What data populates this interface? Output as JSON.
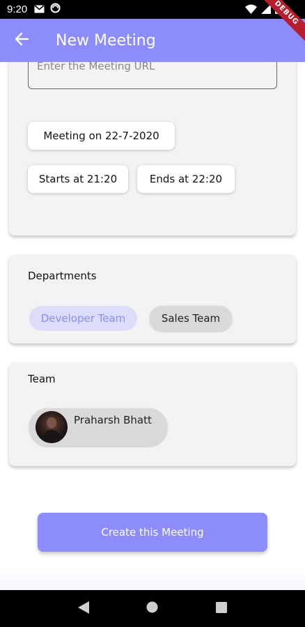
{
  "status_bar": {
    "time": "9:20",
    "icons": [
      "gmail-icon",
      "sync-icon",
      "wifi-icon",
      "signal-icon",
      "battery-icon"
    ]
  },
  "debug_banner": "DEBUG",
  "app_bar": {
    "title": "New Meeting",
    "back_icon": "arrow-back-icon",
    "background": "#8c8cfb"
  },
  "meeting_details": {
    "url_placeholder": "Enter the Meeting URL",
    "date_label": "Meeting on 22-7-2020",
    "start_label": "Starts at 21:20",
    "end_label": "Ends at 22:20"
  },
  "departments": {
    "heading": "Departments",
    "chips": [
      {
        "label": "Developer Team",
        "selected": true
      },
      {
        "label": "Sales Team",
        "selected": false
      }
    ]
  },
  "team": {
    "heading": "Team",
    "members": [
      {
        "name": "Praharsh Bhatt"
      }
    ]
  },
  "actions": {
    "create_label": "Create this Meeting"
  },
  "colors": {
    "accent": "#8c8cfb",
    "accent_light": "#dcdcfb",
    "card_bg": "#f3f3f3"
  },
  "nav_bar": {
    "buttons": [
      "back-triangle-icon",
      "home-circle-icon",
      "recents-square-icon"
    ]
  }
}
